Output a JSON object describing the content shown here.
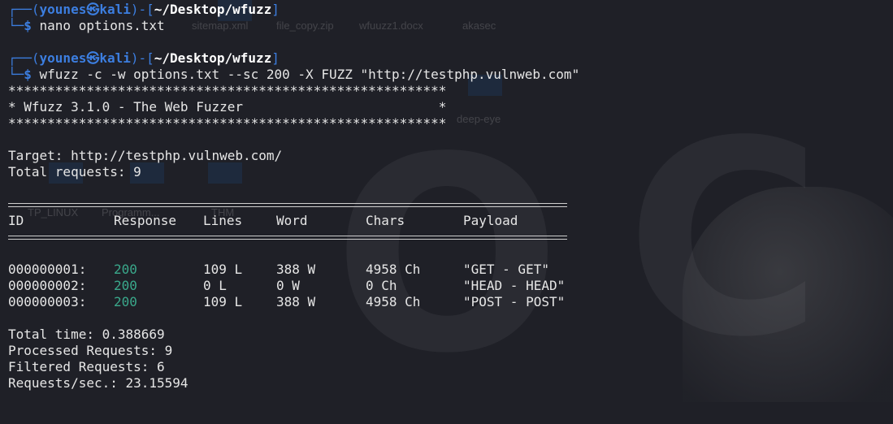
{
  "wallpaper": {
    "desktop_labels": [
      "sitemap.xml",
      "file_copy.zip",
      "wfuuzz1.docx",
      "akasec",
      "TP_LINUX",
      "Programm...",
      "THM",
      "deep-eye"
    ],
    "letters": [
      "O",
      "C"
    ]
  },
  "prompt1": {
    "user": "younes",
    "host": "kali",
    "path": "~/Desktop/wfuzz",
    "command": "nano options.txt"
  },
  "prompt2": {
    "user": "younes",
    "host": "kali",
    "path": "~/Desktop/wfuzz",
    "command": "wfuzz -c -w options.txt --sc 200 -X FUZZ \"http://testphp.vulnweb.com\""
  },
  "banner": {
    "stars": "********************************************************",
    "title": "* Wfuzz 3.1.0 - The Web Fuzzer                         *"
  },
  "summary": {
    "target": "Target: http://testphp.vulnweb.com/",
    "total_requests": "Total requests: 9"
  },
  "table": {
    "headers": {
      "id": "ID",
      "response": "Response",
      "lines": "Lines",
      "word": "Word",
      "chars": "Chars",
      "payload": "Payload"
    },
    "rows": [
      {
        "id": "000000001:",
        "response": "200",
        "lines": "109 L",
        "word": "388 W",
        "chars": "4958 Ch",
        "payload": "\"GET - GET\""
      },
      {
        "id": "000000002:",
        "response": "200",
        "lines": "0 L",
        "word": "0 W",
        "chars": "0 Ch",
        "payload": "\"HEAD - HEAD\""
      },
      {
        "id": "000000003:",
        "response": "200",
        "lines": "109 L",
        "word": "388 W",
        "chars": "4958 Ch",
        "payload": "\"POST - POST\""
      }
    ]
  },
  "stats": {
    "total_time": "Total time: 0.388669",
    "processed": "Processed Requests: 9",
    "filtered": "Filtered Requests: 6",
    "rate": "Requests/sec.: 23.15594"
  },
  "colors": {
    "prompt": "#3c7ee0",
    "status_ok": "#3aa88b",
    "background": "#1f2027"
  }
}
